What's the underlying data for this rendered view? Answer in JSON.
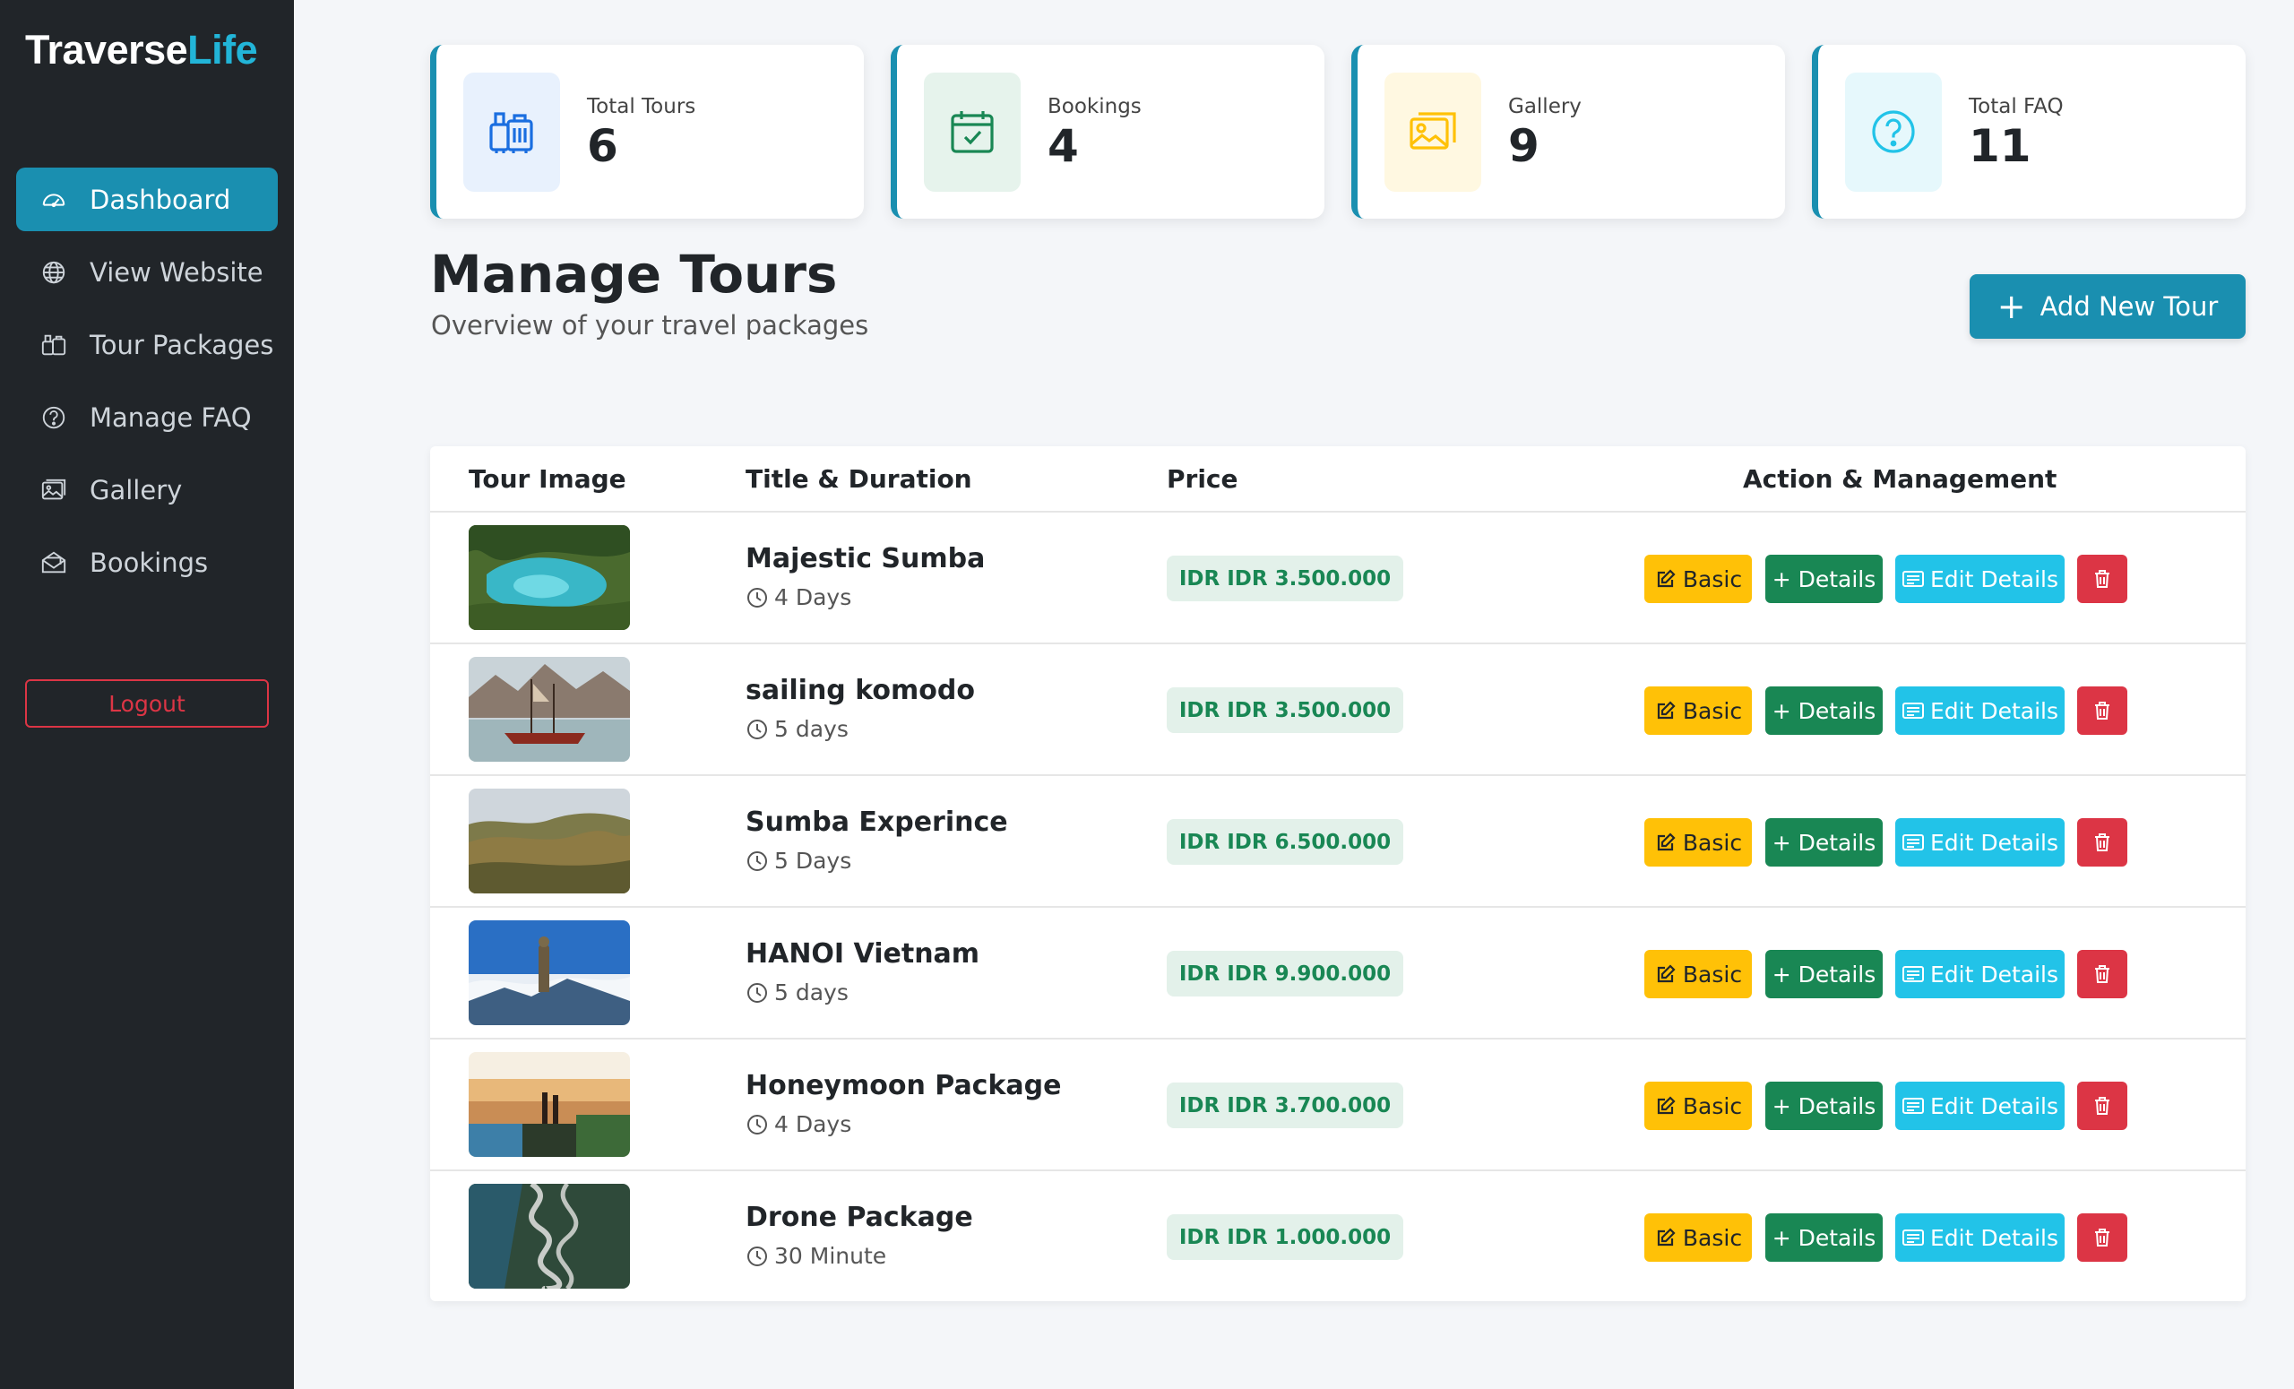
{
  "brand": {
    "part1": "Traverse",
    "part2": "Life"
  },
  "sidebar": {
    "items": [
      {
        "label": "Dashboard",
        "icon": "speedometer-icon",
        "active": true
      },
      {
        "label": "View Website",
        "icon": "globe-icon"
      },
      {
        "label": "Tour Packages",
        "icon": "suitcase-icon"
      },
      {
        "label": "Manage FAQ",
        "icon": "question-circle-icon"
      },
      {
        "label": "Gallery",
        "icon": "images-icon"
      },
      {
        "label": "Bookings",
        "icon": "envelope-open-icon"
      }
    ],
    "logout": "Logout"
  },
  "stats": [
    {
      "label": "Total Tours",
      "value": "6",
      "icon": "luggage-icon",
      "color": "#1a6ee0",
      "bg": "#e8f1fd"
    },
    {
      "label": "Bookings",
      "value": "4",
      "icon": "calendar-check-icon",
      "color": "#198754",
      "bg": "#e6f3ec"
    },
    {
      "label": "Gallery",
      "value": "9",
      "icon": "images-icon",
      "color": "#ffc107",
      "bg": "#fff8e1"
    },
    {
      "label": "Total FAQ",
      "value": "11",
      "icon": "question-circle-icon",
      "color": "#22c3e8",
      "bg": "#e6f8fc"
    }
  ],
  "header": {
    "title": "Manage Tours",
    "subtitle": "Overview of your travel packages",
    "add_button": "Add New Tour"
  },
  "table": {
    "columns": [
      "Tour Image",
      "Title & Duration",
      "Price",
      "Action & Management"
    ],
    "actions": {
      "basic": "Basic",
      "details": "+ Details",
      "edit": "Edit Details"
    },
    "rows": [
      {
        "title": "Majestic Sumba",
        "duration": "4 Days",
        "price": "IDR IDR 3.500.000"
      },
      {
        "title": "sailing komodo",
        "duration": "5 days",
        "price": "IDR IDR 3.500.000"
      },
      {
        "title": "Sumba Experince",
        "duration": "5 Days",
        "price": "IDR IDR 6.500.000"
      },
      {
        "title": "HANOI Vietnam",
        "duration": "5 days",
        "price": "IDR IDR 9.900.000"
      },
      {
        "title": "Honeymoon Package",
        "duration": "4 Days",
        "price": "IDR IDR 3.700.000"
      },
      {
        "title": "Drone Package",
        "duration": "30 Minute",
        "price": "IDR IDR 1.000.000"
      }
    ]
  },
  "colors": {
    "sidebar_bg": "#212529",
    "accent": "#1a8fb0",
    "brand_accent": "#22b5d8"
  }
}
